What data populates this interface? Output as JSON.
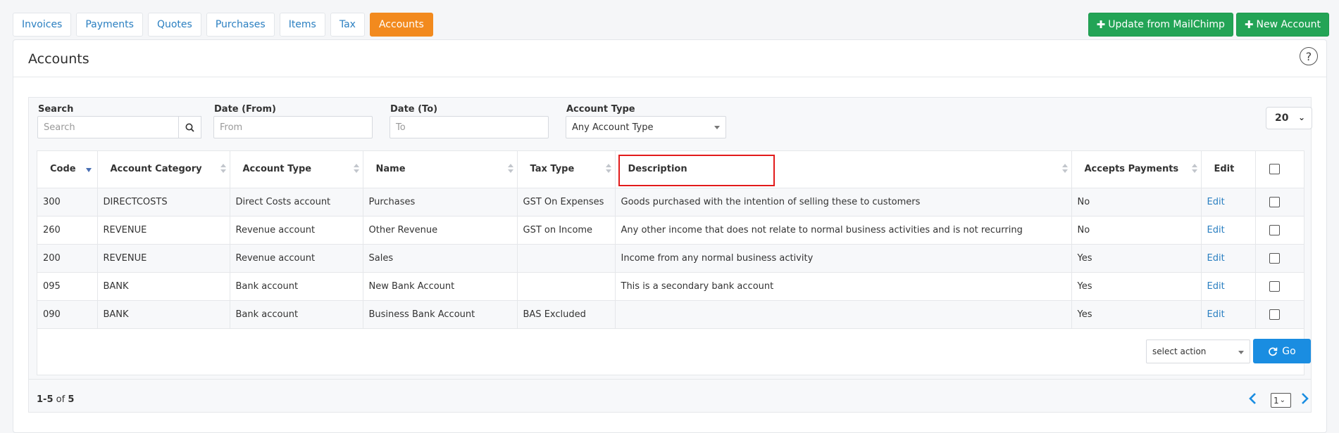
{
  "tabs": [
    {
      "label": "Invoices",
      "active": false
    },
    {
      "label": "Payments",
      "active": false
    },
    {
      "label": "Quotes",
      "active": false
    },
    {
      "label": "Purchases",
      "active": false
    },
    {
      "label": "Items",
      "active": false
    },
    {
      "label": "Tax",
      "active": false
    },
    {
      "label": "Accounts",
      "active": true
    }
  ],
  "top_actions": {
    "update_mailchimp": "Update from MailChimp",
    "new_account": "New Account"
  },
  "page": {
    "title": "Accounts",
    "help_icon": "?"
  },
  "filters": {
    "search_label": "Search",
    "search_placeholder": "Search",
    "date_from_label": "Date (From)",
    "date_from_placeholder": "From",
    "date_to_label": "Date (To)",
    "date_to_placeholder": "To",
    "account_type_label": "Account Type",
    "account_type_value": "Any Account Type",
    "per_page": "20"
  },
  "table": {
    "headers": {
      "code": "Code",
      "category": "Account Category",
      "type": "Account Type",
      "name": "Name",
      "tax": "Tax Type",
      "description": "Description",
      "accepts": "Accepts Payments",
      "edit": "Edit"
    },
    "rows": [
      {
        "code": "300",
        "category": "DIRECTCOSTS",
        "type": "Direct Costs account",
        "name": "Purchases",
        "tax": "GST On Expenses",
        "description": "Goods purchased with the intention of selling these to customers",
        "accepts": "No",
        "edit": "Edit"
      },
      {
        "code": "260",
        "category": "REVENUE",
        "type": "Revenue account",
        "name": "Other Revenue",
        "tax": "GST on Income",
        "description": "Any other income that does not relate to normal business activities and is not recurring",
        "accepts": "No",
        "edit": "Edit"
      },
      {
        "code": "200",
        "category": "REVENUE",
        "type": "Revenue account",
        "name": "Sales",
        "tax": "",
        "description": "Income from any normal business activity",
        "accepts": "Yes",
        "edit": "Edit"
      },
      {
        "code": "095",
        "category": "BANK",
        "type": "Bank account",
        "name": "New Bank Account",
        "tax": "",
        "description": "This is a secondary bank account",
        "accepts": "Yes",
        "edit": "Edit"
      },
      {
        "code": "090",
        "category": "BANK",
        "type": "Bank account",
        "name": "Business Bank Account",
        "tax": "BAS Excluded",
        "description": "",
        "accepts": "Yes",
        "edit": "Edit"
      }
    ]
  },
  "bulk": {
    "action_placeholder": "select action",
    "go_label": "Go"
  },
  "pagination": {
    "range": "1-5",
    "of": "of",
    "total": "5",
    "current_page": "1"
  },
  "colors": {
    "accent": "#f28a1e",
    "green": "#23a456",
    "blue": "#1a8de1",
    "link": "#2a7fc1",
    "highlight": "#e21b1b"
  }
}
